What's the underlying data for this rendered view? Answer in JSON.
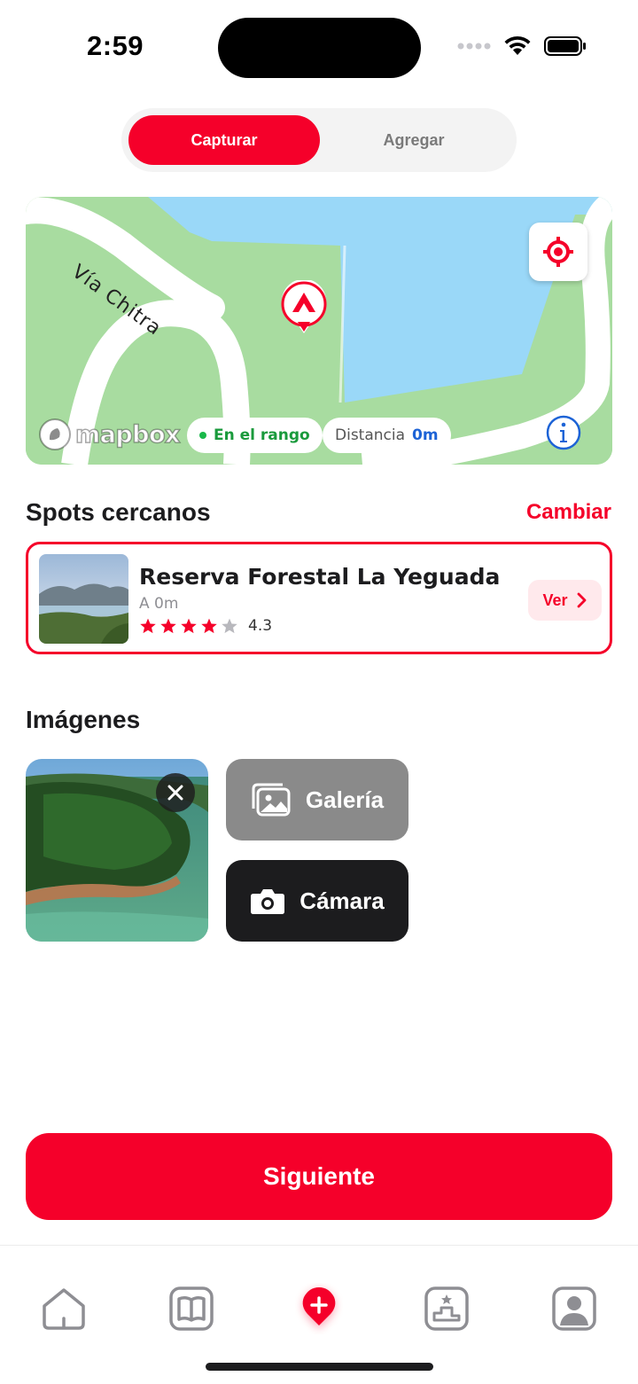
{
  "status_bar": {
    "time": "2:59"
  },
  "segmented": {
    "active": "Capturar",
    "inactive": "Agregar"
  },
  "map": {
    "road_label": "Vía Chitra",
    "attribution": "mapbox",
    "range_chip": "En el rango",
    "distance_label": "Distancia",
    "distance_value": "0m",
    "colors": {
      "land": "#a8dca0",
      "water": "#9ad8f8",
      "road": "#ffffff"
    }
  },
  "spots": {
    "title": "Spots cercanos",
    "change_label": "Cambiar",
    "items": [
      {
        "name": "Reserva Forestal La Yeguada",
        "distance": "A 0m",
        "rating": "4.3",
        "stars": 4,
        "view_label": "Ver"
      }
    ]
  },
  "images": {
    "title": "Imágenes",
    "gallery_label": "Galería",
    "camera_label": "Cámara"
  },
  "next_label": "Siguiente",
  "colors": {
    "accent": "#f5002a",
    "dark": "#1c1c1e",
    "gray_button": "#8a8a8a"
  },
  "tabbar": {
    "items": [
      "home-icon",
      "book-icon",
      "add-icon",
      "leaderboard-icon",
      "profile-icon"
    ]
  }
}
